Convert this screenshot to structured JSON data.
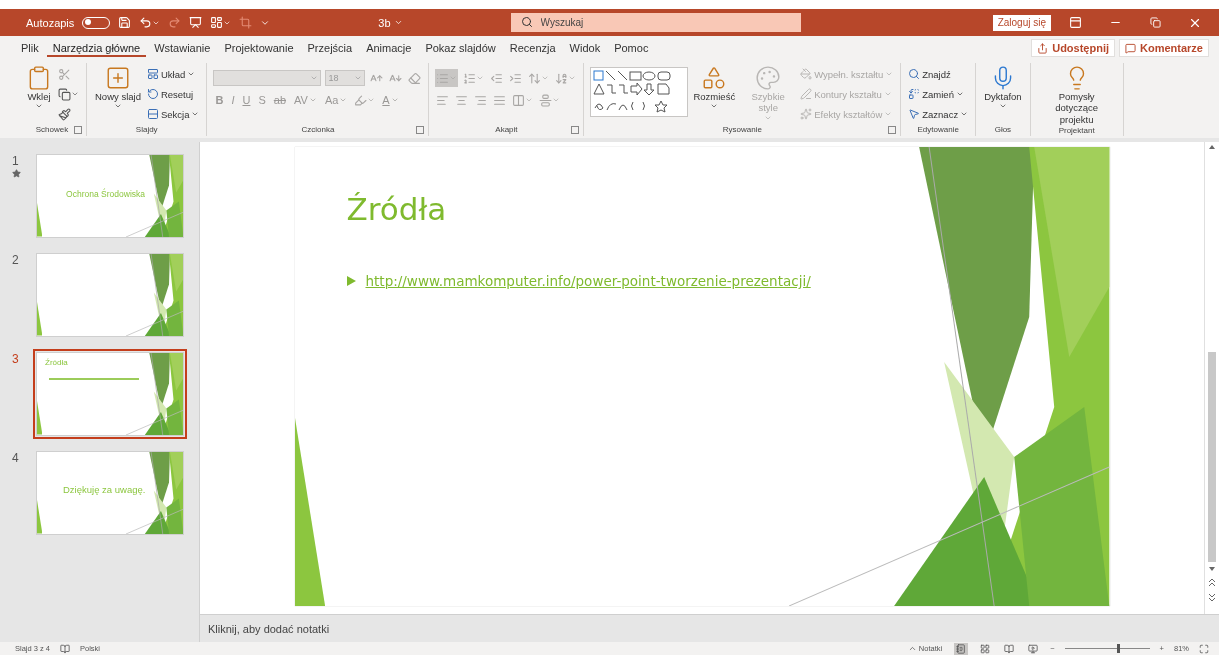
{
  "title_bar": {
    "autosave_label": "Autozapis",
    "autosave_on": false,
    "document_title": "3b",
    "search": {
      "placeholder": "Wyszukaj"
    },
    "sign_in": "Zaloguj się"
  },
  "tabs": [
    {
      "label": "Plik",
      "selected": false
    },
    {
      "label": "Narzędzia główne",
      "selected": true
    },
    {
      "label": "Wstawianie",
      "selected": false
    },
    {
      "label": "Projektowanie",
      "selected": false
    },
    {
      "label": "Przejścia",
      "selected": false
    },
    {
      "label": "Animacje",
      "selected": false
    },
    {
      "label": "Pokaz slajdów",
      "selected": false
    },
    {
      "label": "Recenzja",
      "selected": false
    },
    {
      "label": "Widok",
      "selected": false
    },
    {
      "label": "Pomoc",
      "selected": false
    }
  ],
  "share_button": "Udostępnij",
  "comments_button": "Komentarze",
  "ribbon": {
    "groups": [
      {
        "label": "Schowek",
        "launcher": true,
        "kind": "columns",
        "lines": [
          [
            {
              "kind": "large",
              "label": "Wklej",
              "dropdown": true,
              "disabled": false
            }
          ],
          [
            {
              "kind": "icon",
              "dropdown": false,
              "disabled": true
            },
            {
              "kind": "icon",
              "dropdown": true,
              "disabled": false
            },
            {
              "kind": "icon",
              "dropdown": false,
              "disabled": false
            }
          ]
        ]
      },
      {
        "label": "Slajdy",
        "launcher": false,
        "kind": "columns",
        "lines": [
          [
            {
              "kind": "large",
              "label": "Nowy slajd",
              "dropdown": true,
              "disabled": false
            }
          ],
          [
            {
              "kind": "small",
              "label": "Układ",
              "dropdown": true,
              "disabled": false
            },
            {
              "kind": "small",
              "label": "Resetuj",
              "dropdown": false,
              "disabled": false
            },
            {
              "kind": "small",
              "label": "Sekcja",
              "dropdown": true,
              "disabled": false
            }
          ]
        ]
      },
      {
        "label": "Czcionka",
        "launcher": true,
        "kind": "rows",
        "lines": [
          [
            {
              "kind": "field",
              "disabled": true
            },
            {
              "kind": "field",
              "label": "18",
              "disabled": true
            },
            {
              "kind": "icon",
              "dropdown": false,
              "disabled": true
            },
            {
              "kind": "icon",
              "dropdown": false,
              "disabled": true
            },
            {
              "kind": "icon",
              "dropdown": false,
              "disabled": true
            }
          ],
          [
            {
              "kind": "glyph",
              "label": "B",
              "dropdown": false,
              "disabled": true
            },
            {
              "kind": "glyph",
              "label": "I",
              "dropdown": false,
              "disabled": true
            },
            {
              "kind": "glyph",
              "label": "U",
              "dropdown": false,
              "disabled": true
            },
            {
              "kind": "glyph",
              "label": "S",
              "dropdown": false,
              "disabled": true
            },
            {
              "kind": "glyph",
              "label": "ab",
              "dropdown": false,
              "disabled": true
            },
            {
              "kind": "glyph",
              "label": "AV",
              "dropdown": true,
              "disabled": true
            },
            {
              "kind": "glyph",
              "label": "Aa",
              "dropdown": true,
              "disabled": true
            },
            {
              "kind": "icon",
              "dropdown": true,
              "disabled": true
            },
            {
              "kind": "glyph",
              "label": "A",
              "dropdown": true,
              "disabled": true
            }
          ]
        ]
      },
      {
        "label": "Akapit",
        "launcher": true,
        "kind": "rows",
        "lines": [
          [
            {
              "kind": "icon",
              "dropdown": true,
              "disabled": true,
              "selected": true
            },
            {
              "kind": "icon",
              "dropdown": true,
              "disabled": true,
              "selected": false
            },
            {
              "kind": "icon",
              "dropdown": false,
              "disabled": true,
              "selected": false
            },
            {
              "kind": "icon",
              "dropdown": false,
              "disabled": true,
              "selected": false
            },
            {
              "kind": "icon",
              "dropdown": true,
              "disabled": true,
              "selected": false
            },
            {
              "kind": "icon",
              "dropdown": true,
              "disabled": true,
              "selected": false
            }
          ],
          [
            {
              "kind": "icon",
              "dropdown": false,
              "disabled": true,
              "selected": false
            },
            {
              "kind": "icon",
              "dropdown": false,
              "disabled": true,
              "selected": false
            },
            {
              "kind": "icon",
              "dropdown": false,
              "disabled": true,
              "selected": false
            },
            {
              "kind": "icon",
              "dropdown": false,
              "disabled": true,
              "selected": false
            },
            {
              "kind": "icon",
              "dropdown": true,
              "disabled": true,
              "selected": false
            },
            {
              "kind": "icon",
              "dropdown": true,
              "disabled": true,
              "selected": false
            }
          ]
        ]
      },
      {
        "label": "Rysowanie",
        "launcher": true,
        "kind": "columns",
        "lines": [
          [
            {
              "kind": "gallery"
            }
          ],
          [
            {
              "kind": "large",
              "label": "Rozmieść",
              "dropdown": true,
              "disabled": false
            }
          ],
          [
            {
              "kind": "large",
              "label": "Szybkie style",
              "dropdown": true,
              "disabled": true
            }
          ],
          [
            {
              "kind": "small",
              "label": "Wypełn. kształtu",
              "dropdown": true,
              "disabled": true
            },
            {
              "kind": "small",
              "label": "Kontury kształtu",
              "dropdown": true,
              "disabled": true
            },
            {
              "kind": "small",
              "label": "Efekty kształtów",
              "dropdown": true,
              "disabled": true
            }
          ]
        ]
      },
      {
        "label": "Edytowanie",
        "launcher": false,
        "kind": "columns",
        "lines": [
          [
            {
              "kind": "small",
              "label": "Znajdź",
              "dropdown": false,
              "disabled": false
            },
            {
              "kind": "small",
              "label": "Zamień",
              "dropdown": true,
              "disabled": false
            },
            {
              "kind": "small",
              "label": "Zaznacz",
              "dropdown": true,
              "disabled": false
            }
          ]
        ]
      },
      {
        "label": "Głos",
        "launcher": false,
        "kind": "columns",
        "lines": [
          [
            {
              "kind": "large",
              "label": "Dyktafon",
              "dropdown": true,
              "disabled": false
            }
          ]
        ]
      },
      {
        "label": "Projektant",
        "launcher": false,
        "kind": "columns",
        "lines": [
          [
            {
              "kind": "large",
              "label": "Pomysły dotyczące projektu",
              "dropdown": false,
              "disabled": false
            }
          ]
        ]
      }
    ]
  },
  "slides": [
    {
      "number": "1",
      "title": "Ochrona Środowiska",
      "kind": "title",
      "selected": false,
      "has_transition": true
    },
    {
      "number": "2",
      "kind": "blank",
      "selected": false,
      "has_transition": false
    },
    {
      "number": "3",
      "title": "Źródła",
      "kind": "content",
      "selected": true,
      "has_transition": false
    },
    {
      "number": "4",
      "title": "Dziękuję za uwagę.",
      "kind": "closing",
      "selected": false,
      "has_transition": false
    }
  ],
  "current_slide": {
    "title": "Źródła",
    "bullets": [
      {
        "kind": "link",
        "text": "http://www.mamkomputer.info/power-point-tworzenie-prezentacji/"
      }
    ]
  },
  "notes": {
    "placeholder": "Kliknij, aby dodać notatki"
  },
  "status_bar": {
    "slide_info": "Slajd 3 z 4",
    "language": "Polski",
    "notes_button": "Notatki",
    "zoom_out": "−",
    "zoom_in": "+",
    "zoom": {
      "level": 0.62,
      "reading": "81%"
    }
  }
}
